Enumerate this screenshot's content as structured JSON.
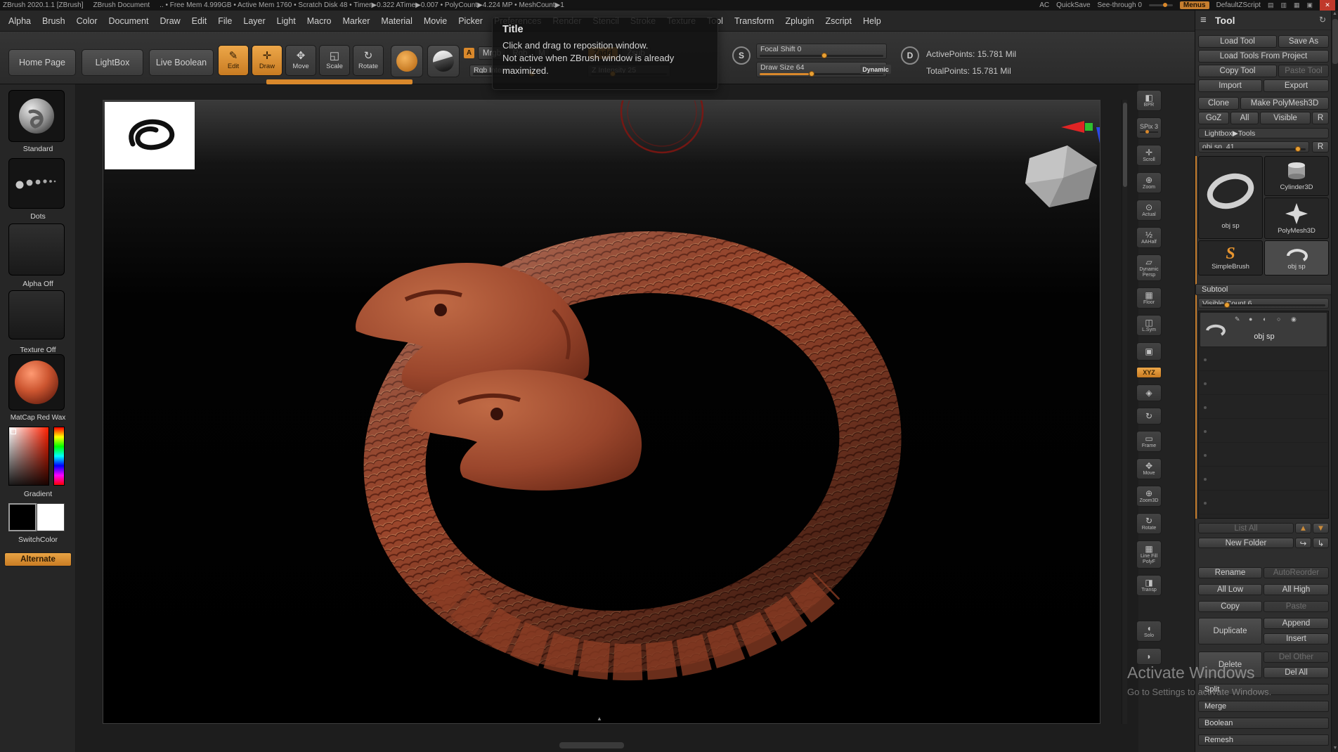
{
  "title_bar": {
    "app": "ZBrush 2020.1.1 [ZBrush]",
    "doc": "ZBrush Document",
    "stats": ".. • Free Mem 4.999GB • Active Mem 1760 • Scratch Disk 48 • Timer▶0.322 ATime▶0.007 • PolyCount▶4.224 MP • MeshCount▶1",
    "ac": "AC",
    "quicksave": "QuickSave",
    "seethrough": "See-through 0",
    "menus": "Menus",
    "zscript": "DefaultZScript"
  },
  "icons": {
    "close": "✕",
    "hamburger": "≡",
    "refresh": "↻",
    "win1": "▤",
    "win2": "▥",
    "win3": "▦",
    "win4": "▣",
    "up": "▲",
    "down": "▼",
    "redo": "↪",
    "branch": "↳",
    "tri_up": "▲"
  },
  "menu": {
    "items": [
      "Alpha",
      "Brush",
      "Color",
      "Document",
      "Draw",
      "Edit",
      "File",
      "Layer",
      "Light",
      "Macro",
      "Marker",
      "Material",
      "Movie",
      "Picker",
      "Preferences",
      "Render",
      "Stencil",
      "Stroke",
      "Texture",
      "Tool",
      "Transform",
      "Zplugin",
      "Zscript",
      "Help"
    ]
  },
  "tooltip": {
    "title": "Title",
    "line1": "Click and drag to reposition window.",
    "line2": "Not active when ZBrush window is already maximized."
  },
  "toolbar": {
    "home_page": "Home Page",
    "lightbox": "LightBox",
    "live_boolean": "Live Boolean",
    "edit": "Edit",
    "edit_icon": "✎",
    "draw": "Draw",
    "draw_icon": "✛",
    "move": "Move",
    "move_icon": "✥",
    "scale": "Scale",
    "scale_icon": "◱",
    "rotate": "Rotate",
    "rotate_icon": "↻",
    "a_badge": "A",
    "mrgb": "Mrgb",
    "rgb": "Rgb",
    "m": "M",
    "rgb_intensity": "Rgb Intensi",
    "zadd": "Zadd",
    "zsub": "Zsub",
    "z_intensity": "Z Intensity 25",
    "s_badge": "S",
    "focal_shift": "Focal Shift 0",
    "draw_size": "Draw Size 64",
    "dynamic": "Dynamic",
    "d_badge": "D",
    "active_points": "ActivePoints: 15.781 Mil",
    "total_points": "TotalPoints: 15.781 Mil"
  },
  "sidebar": {
    "standard": "Standard",
    "dots": "Dots",
    "alpha_off": "Alpha Off",
    "texture_off": "Texture Off",
    "matcap": "MatCap Red Wax",
    "gradient": "Gradient",
    "switchcolor": "SwitchColor",
    "alternate": "Alternate"
  },
  "strip": {
    "items": [
      {
        "name": "bpr",
        "label": "BPR",
        "glyph": "◧"
      },
      {
        "name": "spix",
        "label": "SPix 3",
        "glyph": ""
      },
      {
        "name": "scroll",
        "label": "Scroll",
        "glyph": "✛"
      },
      {
        "name": "zoom",
        "label": "Zoom",
        "glyph": "⊕"
      },
      {
        "name": "actual",
        "label": "Actual",
        "glyph": "⊙"
      },
      {
        "name": "aahalf",
        "label": "AAHalf",
        "glyph": "½"
      },
      {
        "name": "dynamic-persp",
        "label": "Dynamic Persp",
        "glyph": "▱"
      },
      {
        "name": "floor",
        "label": "Floor",
        "glyph": "▦"
      },
      {
        "name": "lsym",
        "label": "L.Sym",
        "glyph": "◫"
      },
      {
        "name": "box",
        "label": "",
        "glyph": "▣"
      },
      {
        "name": "xyz",
        "label": "XYZ",
        "glyph": ""
      },
      {
        "name": "gyro",
        "label": "",
        "glyph": "◈"
      },
      {
        "name": "spin",
        "label": "",
        "glyph": "↻"
      },
      {
        "name": "frame",
        "label": "Frame",
        "glyph": "▭"
      },
      {
        "name": "move3d",
        "label": "Move",
        "glyph": "✥"
      },
      {
        "name": "zoom3d",
        "label": "Zoom3D",
        "glyph": "⊕"
      },
      {
        "name": "rotate3d",
        "label": "Rotate",
        "glyph": "↻"
      },
      {
        "name": "polyf",
        "label": "Line Fill PolyF",
        "glyph": "▦"
      },
      {
        "name": "transp",
        "label": "Transp",
        "glyph": "◨"
      },
      {
        "name": "solo",
        "label": "Solo",
        "glyph": "◖"
      },
      {
        "name": "ghost",
        "label": "",
        "glyph": "◗"
      }
    ]
  },
  "tool_panel": {
    "title": "Tool",
    "load_tool": "Load Tool",
    "save_as": "Save As",
    "load_tools_from_project": "Load Tools From Project",
    "copy_tool": "Copy Tool",
    "paste_tool": "Paste Tool",
    "import": "Import",
    "export": "Export",
    "clone": "Clone",
    "make_polymesh3d": "Make PolyMesh3D",
    "goz": "GoZ",
    "all": "All",
    "visible": "Visible",
    "r": "R",
    "lightbox_tools": "Lightbox▶Tools",
    "active_tool_slider": "obj sp. 41",
    "thumbs": {
      "objsp": "obj sp",
      "cylinder": "Cylinder3D",
      "polymesh": "PolyMesh3D",
      "simplebrush": "SimpleBrush",
      "objsp2": "obj sp",
      "s_glyph": "S"
    },
    "subtool": {
      "header": "Subtool",
      "visible_count": "Visible Count 6",
      "item": "obj sp",
      "item_icons": [
        "✎",
        "●",
        "◐",
        "○",
        "◉"
      ],
      "list_all": "List All",
      "new_folder": "New Folder",
      "rename": "Rename",
      "autoreorder": "AutoReorder",
      "all_low": "All Low",
      "all_high": "All High",
      "copy": "Copy",
      "paste": "Paste",
      "duplicate": "Duplicate",
      "append": "Append",
      "insert": "Insert",
      "delete": "Delete",
      "del_other": "Del Other",
      "del_all": "Del All",
      "split": "Split",
      "merge": "Merge",
      "boolean": "Boolean",
      "remesh": "Remesh"
    }
  },
  "watermark": {
    "line1": "Activate Windows",
    "line2": "Go to Settings to activate Windows."
  }
}
